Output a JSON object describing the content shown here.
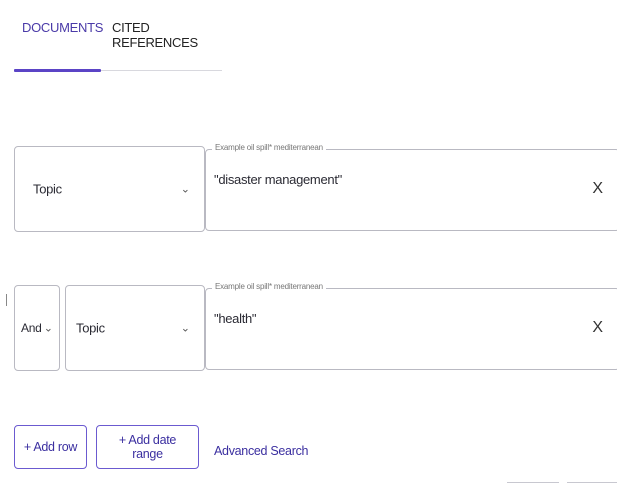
{
  "tabs": [
    {
      "label": "DOCUMENTS",
      "active": true
    },
    {
      "label": "CITED REFERENCES",
      "active": false
    }
  ],
  "rows": [
    {
      "field_select": "Topic",
      "placeholder": "Example oil spill* mediterranean",
      "value": "\"disaster management\"",
      "clear_label": "X"
    },
    {
      "operator": "And",
      "field_select": "Topic",
      "placeholder": "Example oil spill* mediterranean",
      "value": "\"health\"",
      "clear_label": "X"
    }
  ],
  "chevron": "⌄",
  "actions": {
    "add_row": "+ Add row",
    "add_date_range": "+ Add date range",
    "advanced_search": "Advanced Search"
  },
  "colors": {
    "accent": "#5b44c6",
    "link": "#3b2fa0",
    "border": "#b9b9c2"
  }
}
